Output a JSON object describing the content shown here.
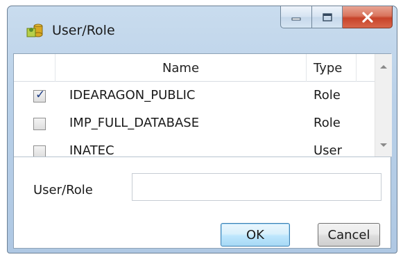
{
  "window": {
    "title": "User/Role",
    "app_icon": "database-icon"
  },
  "caption_buttons": [
    "minimize-icon",
    "maximize-icon",
    "close-icon"
  ],
  "grid": {
    "columns": [
      "Name",
      "Type"
    ],
    "rows": [
      {
        "checked": true,
        "name": "IDEARAGON_PUBLIC",
        "type": "Role"
      },
      {
        "checked": false,
        "name": "IMP_FULL_DATABASE",
        "type": "Role"
      },
      {
        "checked": false,
        "name": "INATEC",
        "type": "User"
      }
    ]
  },
  "form": {
    "userrole_label": "User/Role",
    "userrole_value": ""
  },
  "buttons": {
    "ok": "OK",
    "cancel": "Cancel"
  },
  "colors": {
    "titlebar": "#b9d0e8",
    "close": "#c7432a",
    "check": "#1b3b84"
  }
}
